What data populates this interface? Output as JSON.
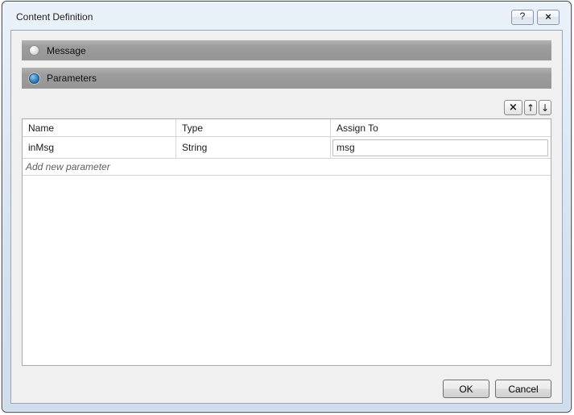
{
  "window": {
    "title": "Content Definition"
  },
  "icons": {
    "help": "?",
    "close": "×",
    "delete": "×",
    "move_up": "↑",
    "move_down": "↓"
  },
  "sections": {
    "message": {
      "label": "Message",
      "selected": false
    },
    "parameters": {
      "label": "Parameters",
      "selected": true
    }
  },
  "table": {
    "columns": [
      "Name",
      "Type",
      "Assign To"
    ],
    "rows": [
      {
        "name": "inMsg",
        "type": "String",
        "assign_to": "msg"
      }
    ],
    "add_row_placeholder": "Add new parameter"
  },
  "footer": {
    "ok_label": "OK",
    "cancel_label": "Cancel"
  },
  "colors": {
    "titlebar_top": "#eaf1f9",
    "titlebar_bottom": "#cfdded",
    "section_bar": "#9a9a9a",
    "radio_selected": "#3c88c9",
    "content_background": "#f0f0f0",
    "table_border": "#a9a9a9",
    "grid_line": "#d6d6d6"
  }
}
